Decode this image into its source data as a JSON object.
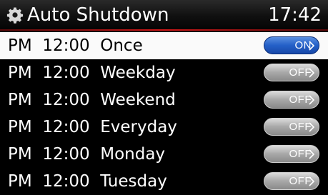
{
  "header": {
    "icon": "gear-icon",
    "title": "Auto Shutdown",
    "clock": "17:42"
  },
  "rows": [
    {
      "label": "PM  12:00  Once",
      "toggle": "ON",
      "selected": true
    },
    {
      "label": "PM  12:00  Weekday",
      "toggle": "OFF",
      "selected": false
    },
    {
      "label": "PM  12:00  Weekend",
      "toggle": "OFF",
      "selected": false
    },
    {
      "label": "PM  12:00  Everyday",
      "toggle": "OFF",
      "selected": false
    },
    {
      "label": "PM  12:00  Monday",
      "toggle": "OFF",
      "selected": false
    },
    {
      "label": "PM  12:00  Tuesday",
      "toggle": "OFF",
      "selected": false
    }
  ],
  "colors": {
    "accent_line": "#d01818",
    "toggle_on": "#2460c8",
    "toggle_off": "#a8a8a8",
    "selected_row": "#fafafa"
  }
}
